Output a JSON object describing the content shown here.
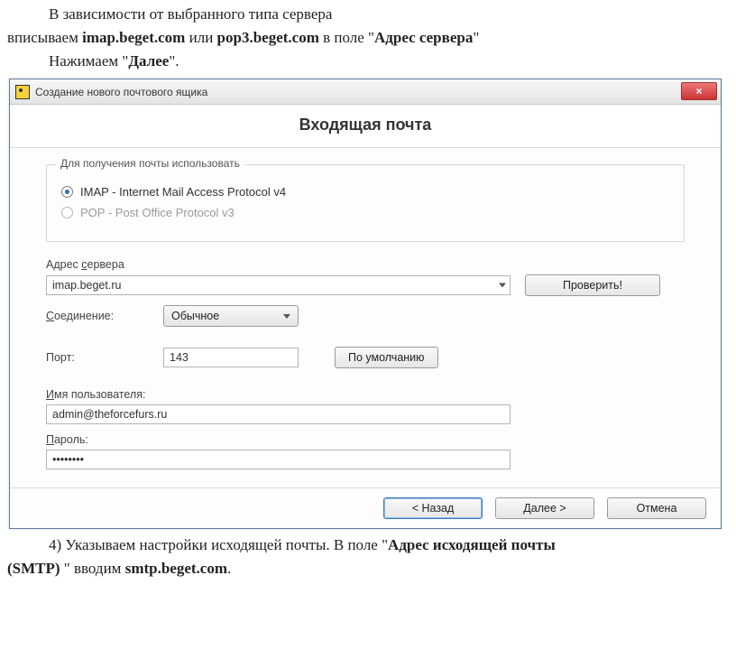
{
  "doc": {
    "p1a": "В зависимости от выбранного типа сервера",
    "p1b_pre": "вписываем ",
    "p1b_imap": "imap.beget.com",
    "p1b_or": " или ",
    "p1b_pop": "pop3.beget.com",
    "p1b_field_pre": " в поле \"",
    "p1b_field": "Адрес сервера",
    "p1b_field_post": "\"",
    "p2_pre": "Нажимаем \"",
    "p2_bold": "Далее",
    "p2_post": "\".",
    "p3_pre": "4) Указываем настройки исходящей почты. В поле \"",
    "p3_bold1": "Адрес исходящей почты",
    "p4_pre": "(SMTP)",
    "p4_mid": " \" вводим ",
    "p4_bold2": "smtp.beget.com",
    "p4_post": "."
  },
  "window": {
    "title": "Создание нового почтового ящика",
    "close_label": "×"
  },
  "header": {
    "title": "Входящая почта"
  },
  "protocol": {
    "legend": "Для получения почты использовать",
    "imap_label": "IMAP - Internet Mail Access Protocol v4",
    "pop_label": "POP  -  Post Office Protocol v3",
    "selected": "imap"
  },
  "server": {
    "label": "Адрес сервера",
    "underline_char": "с",
    "value": "imap.beget.ru",
    "check_btn": "Проверить!"
  },
  "connection": {
    "label": "оединение:",
    "underline_char": "С",
    "value": "Обычное"
  },
  "port": {
    "label": "Порт:",
    "value": "143",
    "default_btn": "По умолчанию"
  },
  "username": {
    "label": "мя пользователя:",
    "underline_char": "И",
    "value": "admin@theforcefurs.ru"
  },
  "password": {
    "label": "ароль:",
    "underline_char": "П",
    "value": "••••••••"
  },
  "buttons": {
    "back": "<  Назад",
    "next": "Далее  >",
    "cancel": "Отмена"
  }
}
